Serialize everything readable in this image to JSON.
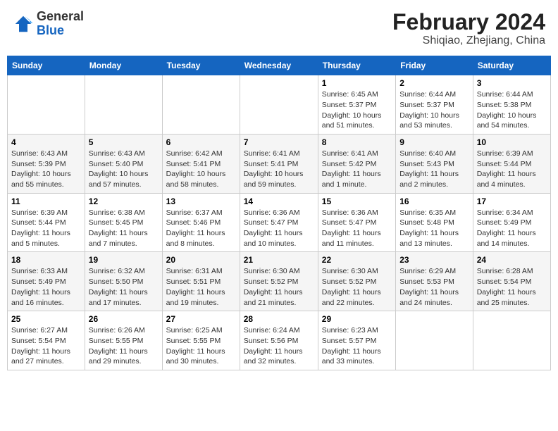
{
  "header": {
    "logo_line1": "General",
    "logo_line2": "Blue",
    "main_title": "February 2024",
    "subtitle": "Shiqiao, Zhejiang, China"
  },
  "weekdays": [
    "Sunday",
    "Monday",
    "Tuesday",
    "Wednesday",
    "Thursday",
    "Friday",
    "Saturday"
  ],
  "weeks": [
    [
      {
        "day": "",
        "info": ""
      },
      {
        "day": "",
        "info": ""
      },
      {
        "day": "",
        "info": ""
      },
      {
        "day": "",
        "info": ""
      },
      {
        "day": "1",
        "info": "Sunrise: 6:45 AM\nSunset: 5:37 PM\nDaylight: 10 hours and 51 minutes."
      },
      {
        "day": "2",
        "info": "Sunrise: 6:44 AM\nSunset: 5:37 PM\nDaylight: 10 hours and 53 minutes."
      },
      {
        "day": "3",
        "info": "Sunrise: 6:44 AM\nSunset: 5:38 PM\nDaylight: 10 hours and 54 minutes."
      }
    ],
    [
      {
        "day": "4",
        "info": "Sunrise: 6:43 AM\nSunset: 5:39 PM\nDaylight: 10 hours and 55 minutes."
      },
      {
        "day": "5",
        "info": "Sunrise: 6:43 AM\nSunset: 5:40 PM\nDaylight: 10 hours and 57 minutes."
      },
      {
        "day": "6",
        "info": "Sunrise: 6:42 AM\nSunset: 5:41 PM\nDaylight: 10 hours and 58 minutes."
      },
      {
        "day": "7",
        "info": "Sunrise: 6:41 AM\nSunset: 5:41 PM\nDaylight: 10 hours and 59 minutes."
      },
      {
        "day": "8",
        "info": "Sunrise: 6:41 AM\nSunset: 5:42 PM\nDaylight: 11 hours and 1 minute."
      },
      {
        "day": "9",
        "info": "Sunrise: 6:40 AM\nSunset: 5:43 PM\nDaylight: 11 hours and 2 minutes."
      },
      {
        "day": "10",
        "info": "Sunrise: 6:39 AM\nSunset: 5:44 PM\nDaylight: 11 hours and 4 minutes."
      }
    ],
    [
      {
        "day": "11",
        "info": "Sunrise: 6:39 AM\nSunset: 5:44 PM\nDaylight: 11 hours and 5 minutes."
      },
      {
        "day": "12",
        "info": "Sunrise: 6:38 AM\nSunset: 5:45 PM\nDaylight: 11 hours and 7 minutes."
      },
      {
        "day": "13",
        "info": "Sunrise: 6:37 AM\nSunset: 5:46 PM\nDaylight: 11 hours and 8 minutes."
      },
      {
        "day": "14",
        "info": "Sunrise: 6:36 AM\nSunset: 5:47 PM\nDaylight: 11 hours and 10 minutes."
      },
      {
        "day": "15",
        "info": "Sunrise: 6:36 AM\nSunset: 5:47 PM\nDaylight: 11 hours and 11 minutes."
      },
      {
        "day": "16",
        "info": "Sunrise: 6:35 AM\nSunset: 5:48 PM\nDaylight: 11 hours and 13 minutes."
      },
      {
        "day": "17",
        "info": "Sunrise: 6:34 AM\nSunset: 5:49 PM\nDaylight: 11 hours and 14 minutes."
      }
    ],
    [
      {
        "day": "18",
        "info": "Sunrise: 6:33 AM\nSunset: 5:49 PM\nDaylight: 11 hours and 16 minutes."
      },
      {
        "day": "19",
        "info": "Sunrise: 6:32 AM\nSunset: 5:50 PM\nDaylight: 11 hours and 17 minutes."
      },
      {
        "day": "20",
        "info": "Sunrise: 6:31 AM\nSunset: 5:51 PM\nDaylight: 11 hours and 19 minutes."
      },
      {
        "day": "21",
        "info": "Sunrise: 6:30 AM\nSunset: 5:52 PM\nDaylight: 11 hours and 21 minutes."
      },
      {
        "day": "22",
        "info": "Sunrise: 6:30 AM\nSunset: 5:52 PM\nDaylight: 11 hours and 22 minutes."
      },
      {
        "day": "23",
        "info": "Sunrise: 6:29 AM\nSunset: 5:53 PM\nDaylight: 11 hours and 24 minutes."
      },
      {
        "day": "24",
        "info": "Sunrise: 6:28 AM\nSunset: 5:54 PM\nDaylight: 11 hours and 25 minutes."
      }
    ],
    [
      {
        "day": "25",
        "info": "Sunrise: 6:27 AM\nSunset: 5:54 PM\nDaylight: 11 hours and 27 minutes."
      },
      {
        "day": "26",
        "info": "Sunrise: 6:26 AM\nSunset: 5:55 PM\nDaylight: 11 hours and 29 minutes."
      },
      {
        "day": "27",
        "info": "Sunrise: 6:25 AM\nSunset: 5:55 PM\nDaylight: 11 hours and 30 minutes."
      },
      {
        "day": "28",
        "info": "Sunrise: 6:24 AM\nSunset: 5:56 PM\nDaylight: 11 hours and 32 minutes."
      },
      {
        "day": "29",
        "info": "Sunrise: 6:23 AM\nSunset: 5:57 PM\nDaylight: 11 hours and 33 minutes."
      },
      {
        "day": "",
        "info": ""
      },
      {
        "day": "",
        "info": ""
      }
    ]
  ]
}
